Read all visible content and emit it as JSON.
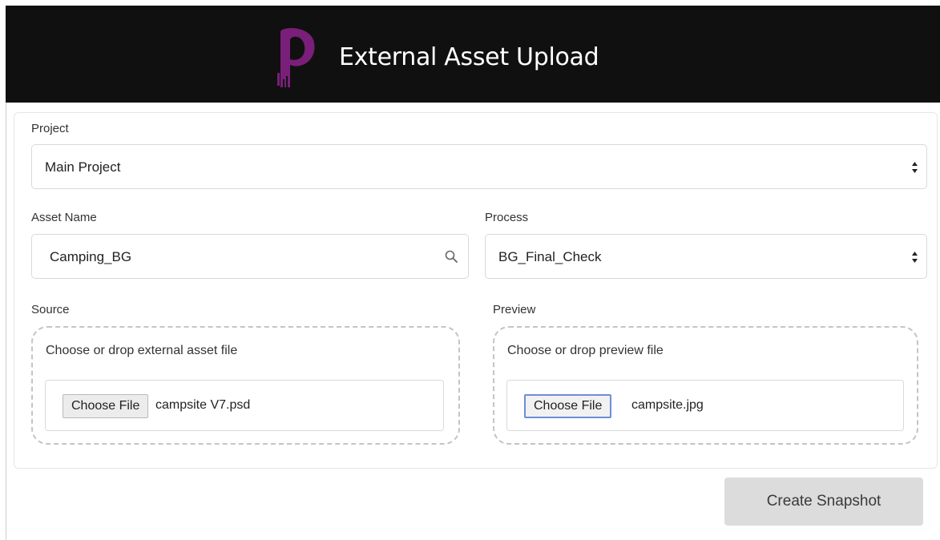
{
  "header": {
    "title": "External Asset Upload",
    "logo_icon": "brand-p-logo",
    "background": "#101010",
    "brand_color": "#7a1f79"
  },
  "form": {
    "project": {
      "label": "Project",
      "value": "Main Project"
    },
    "asset_name": {
      "label": "Asset Name",
      "value": "Camping_BG"
    },
    "process": {
      "label": "Process",
      "value": "BG_Final_Check"
    },
    "source": {
      "label": "Source",
      "hint": "Choose or drop external asset file",
      "button_label": "Choose File",
      "file_name": "campsite V7.psd"
    },
    "preview": {
      "label": "Preview",
      "hint": "Choose or drop preview file",
      "button_label": "Choose File",
      "file_name": "campsite.jpg"
    }
  },
  "actions": {
    "submit_label": "Create Snapshot"
  }
}
